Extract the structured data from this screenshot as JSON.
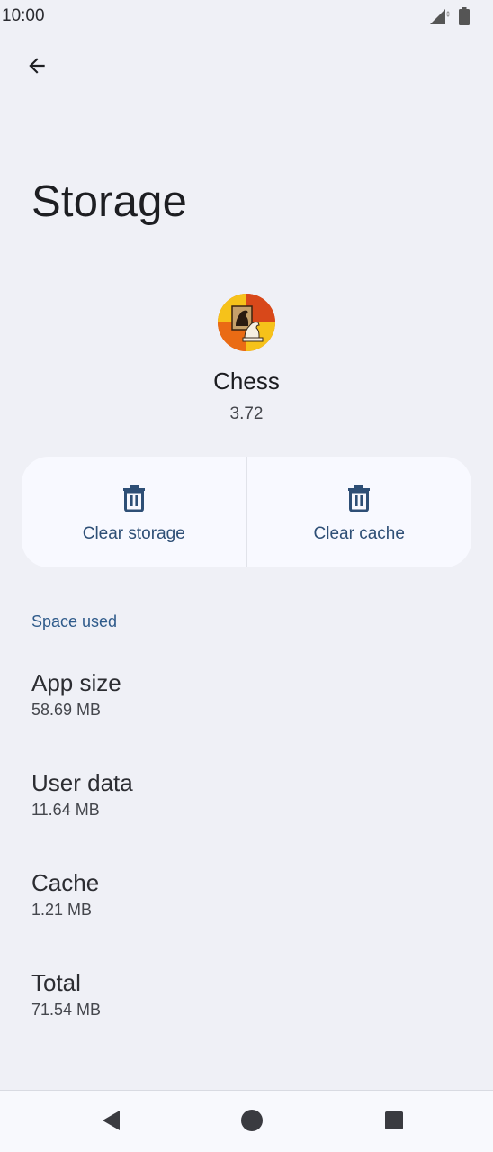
{
  "status_bar": {
    "time": "10:00",
    "icons": [
      "signal-icon",
      "battery-icon"
    ]
  },
  "header": {
    "back_icon": "arrow-back-icon",
    "title": "Storage"
  },
  "app": {
    "name": "Chess",
    "version": "3.72",
    "icon": "chess-app-icon"
  },
  "actions": [
    {
      "label": "Clear storage",
      "icon": "trash-icon"
    },
    {
      "label": "Clear cache",
      "icon": "trash-icon"
    }
  ],
  "section": {
    "header": "Space used"
  },
  "stats": [
    {
      "title": "App size",
      "value": "58.69 MB"
    },
    {
      "title": "User data",
      "value": "11.64 MB"
    },
    {
      "title": "Cache",
      "value": "1.21 MB"
    },
    {
      "title": "Total",
      "value": "71.54 MB"
    }
  ],
  "nav": {
    "buttons": [
      "nav-back-icon",
      "nav-home-icon",
      "nav-recents-icon"
    ]
  },
  "colors": {
    "background": "#eff0f6",
    "accent": "#2e4f76",
    "card": "#f8f9ff"
  }
}
